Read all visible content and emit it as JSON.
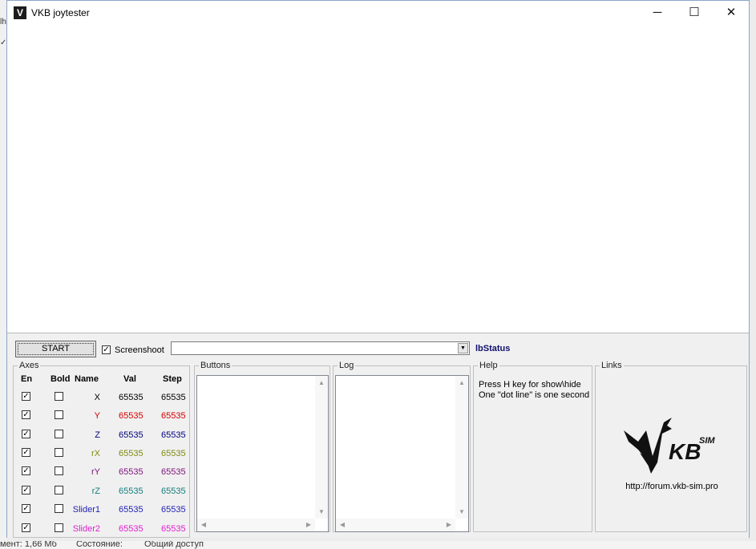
{
  "background": {
    "left_fragments": [
      "lh",
      "✓"
    ],
    "bottom_fragments": [
      "мент: 1,66 Мб",
      "Состояние:",
      "Общий доступ"
    ]
  },
  "window": {
    "title": "VKB joytester",
    "icon": "vkb-app-icon",
    "controls": {
      "minimize": "─",
      "maximize": "☐",
      "close": "✕"
    }
  },
  "toolbar": {
    "start_label": "START",
    "screenshot_label": "Screenshoot",
    "screenshot_checked": "✓",
    "combo_value": "",
    "combo_arrow": "▼",
    "status": "lbStatus"
  },
  "axes": {
    "title": "Axes",
    "headers": {
      "en": "En",
      "bold": "Bold",
      "name": "Name",
      "val": "Val",
      "step": "Step"
    },
    "rows": [
      {
        "en": "✓",
        "bold": "",
        "name": "X",
        "val": "65535",
        "step": "65535",
        "color": "#000000"
      },
      {
        "en": "✓",
        "bold": "",
        "name": "Y",
        "val": "65535",
        "step": "65535",
        "color": "#d40000"
      },
      {
        "en": "✓",
        "bold": "",
        "name": "Z",
        "val": "65535",
        "step": "65535",
        "color": "#00007c"
      },
      {
        "en": "✓",
        "bold": "",
        "name": "rX",
        "val": "65535",
        "step": "65535",
        "color": "#7f8a10"
      },
      {
        "en": "✓",
        "bold": "",
        "name": "rY",
        "val": "65535",
        "step": "65535",
        "color": "#7c127c"
      },
      {
        "en": "✓",
        "bold": "",
        "name": "rZ",
        "val": "65535",
        "step": "65535",
        "color": "#167c7c"
      },
      {
        "en": "✓",
        "bold": "",
        "name": "Slider1",
        "val": "65535",
        "step": "65535",
        "color": "#1e1eb4"
      },
      {
        "en": "✓",
        "bold": "",
        "name": "Slider2",
        "val": "65535",
        "step": "65535",
        "color": "#e020d0"
      }
    ]
  },
  "buttons_group": {
    "title": "Buttons"
  },
  "log_group": {
    "title": "Log"
  },
  "help": {
    "title": "Help",
    "line1": "Press H key for show\\hide",
    "line2": "One \"dot line\" is one second"
  },
  "links": {
    "title": "Links",
    "url": "http://forum.vkb-sim.pro",
    "logo_text": "KB",
    "logo_sup": "SIM"
  },
  "scroll_arrows": {
    "up": "▲",
    "down": "▼",
    "left": "◀",
    "right": "▶"
  }
}
